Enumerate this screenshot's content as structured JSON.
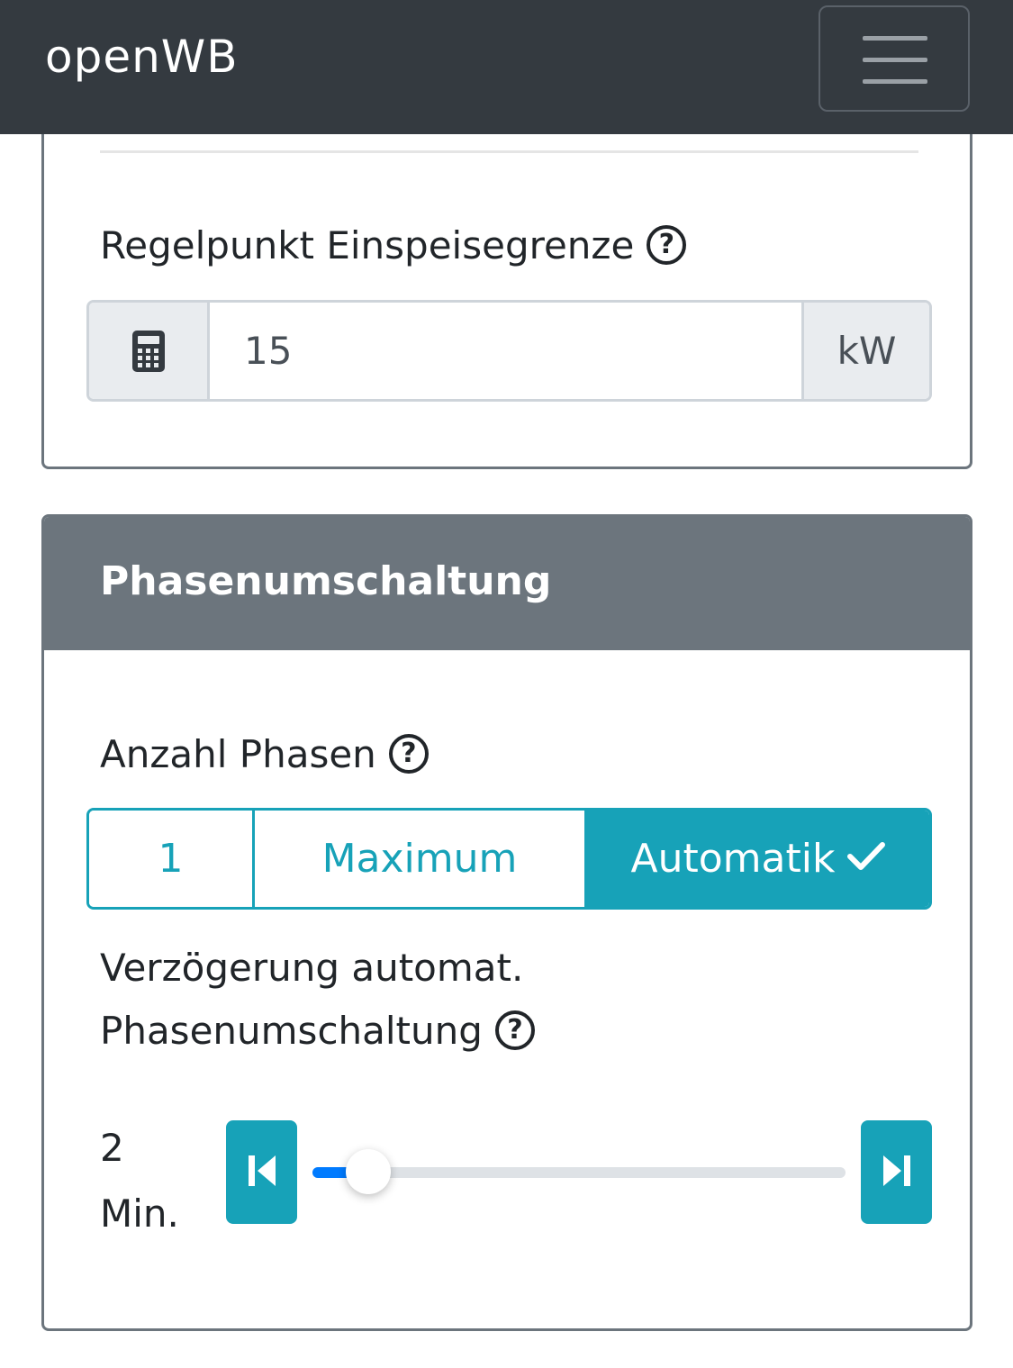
{
  "navbar": {
    "brand": "openWB",
    "menu_icon": "hamburger-menu-icon"
  },
  "feed_in": {
    "label": "Regelpunkt Einspeisegrenze",
    "help_icon": "question-circle-icon",
    "prepend_icon": "calculator-icon",
    "value": "15",
    "unit": "kW"
  },
  "phase_switch": {
    "title": "Phasenumschaltung",
    "phases_label": "Anzahl Phasen",
    "options": [
      {
        "label": "1",
        "selected": false
      },
      {
        "label": "Maximum",
        "selected": false
      },
      {
        "label": "Automatik",
        "selected": true
      }
    ],
    "check_icon": "check-icon",
    "delay_label_line1": "Verzögerung automat.",
    "delay_label_line2": "Phasenumschaltung",
    "delay_value_num": "2",
    "delay_value_unit": "Min.",
    "slider": {
      "fraction": 0.105,
      "prev_icon": "skip-backward-icon",
      "next_icon": "skip-forward-icon"
    }
  },
  "colors": {
    "navbar_bg": "#343a40",
    "card_header_bg": "#6c757d",
    "accent": "#17a2b8",
    "slider_fill": "#007bff"
  }
}
